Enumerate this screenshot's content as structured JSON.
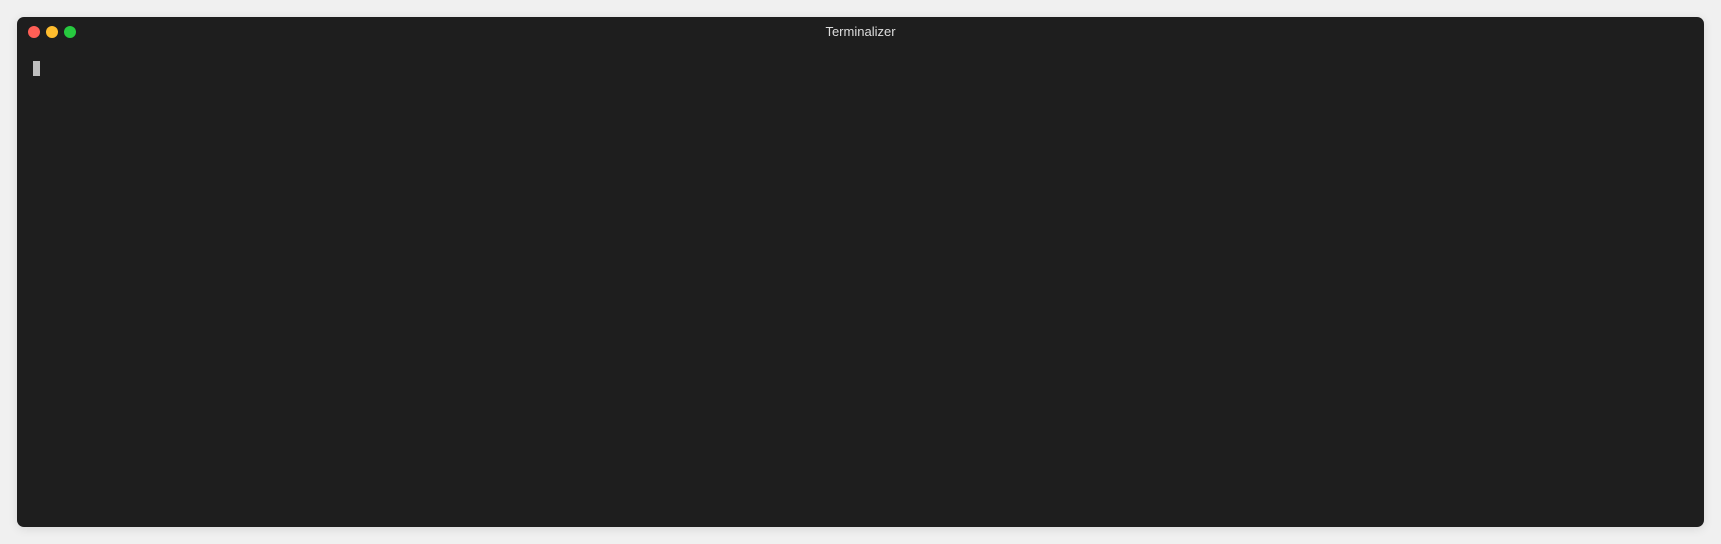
{
  "window": {
    "title": "Terminalizer"
  },
  "controls": {
    "close": "close",
    "minimize": "minimize",
    "maximize": "maximize"
  },
  "terminal": {
    "content": "",
    "cursor_visible": true
  },
  "colors": {
    "background": "#1e1e1e",
    "close": "#ff5f56",
    "minimize": "#ffbd2e",
    "maximize": "#27c93f",
    "cursor": "#bfbfbf",
    "title_text": "#dddddd"
  }
}
